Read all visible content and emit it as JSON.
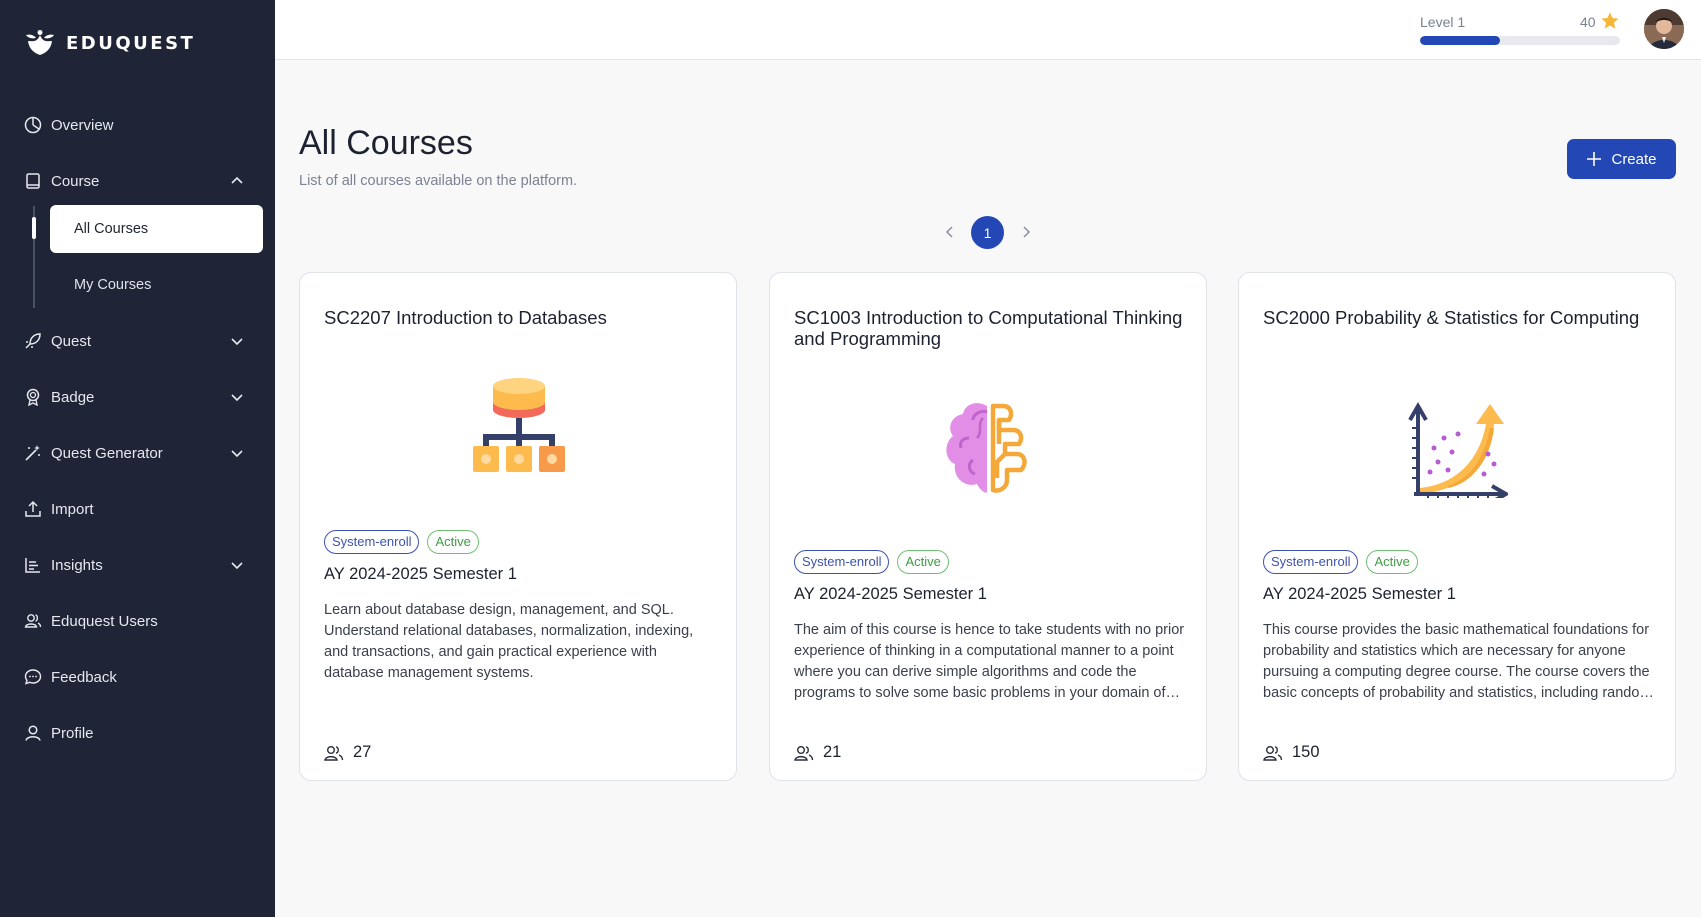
{
  "app": {
    "brand": "EDUQUEST"
  },
  "sidebar": {
    "items": [
      {
        "label": "Overview",
        "icon": "chart-pie-icon"
      },
      {
        "label": "Course",
        "icon": "book-icon",
        "expanded": true
      },
      {
        "label": "Quest",
        "icon": "rocket-icon"
      },
      {
        "label": "Badge",
        "icon": "badge-icon"
      },
      {
        "label": "Quest Generator",
        "icon": "magic-wand-icon"
      },
      {
        "label": "Import",
        "icon": "upload-icon"
      },
      {
        "label": "Insights",
        "icon": "insights-icon"
      },
      {
        "label": "Eduquest Users",
        "icon": "users-icon"
      },
      {
        "label": "Feedback",
        "icon": "chat-icon"
      },
      {
        "label": "Profile",
        "icon": "user-icon"
      }
    ],
    "course_sub": [
      {
        "label": "All Courses",
        "active": true
      },
      {
        "label": "My Courses",
        "active": false
      }
    ]
  },
  "topbar": {
    "level": "Level 1",
    "xp": "40",
    "progress_fraction": 0.4
  },
  "main": {
    "title": "All Courses",
    "subtitle": "List of all courses available on the platform.",
    "create_label": "Create",
    "pagination": {
      "current": "1"
    }
  },
  "courses": [
    {
      "title": "SC2207 Introduction to Databases",
      "image_icon": "database-hierarchy-icon",
      "tags": [
        "System-enroll",
        "Active"
      ],
      "term": "AY 2024-2025 Semester 1",
      "description": "Learn about database design, management, and SQL. Understand relational databases, normalization, indexing, and transactions, and gain practical experience with database management systems.",
      "users": "27"
    },
    {
      "title": "SC1003 Introduction to Computational Thinking and Programming",
      "image_icon": "brain-circuit-icon",
      "tags": [
        "System-enroll",
        "Active"
      ],
      "term": "AY 2024-2025 Semester 1",
      "description": "The aim of this course is hence to take students with no prior experience of thinking in a computational manner to a point where you can derive simple algorithms and code the programs to solve some basic problems in your domain of study.",
      "users": "21"
    },
    {
      "title": "SC2000 Probability & Statistics for Computing",
      "image_icon": "growth-chart-icon",
      "tags": [
        "System-enroll",
        "Active"
      ],
      "term": "AY 2024-2025 Semester 1",
      "description": "This course provides the basic mathematical foundations for probability and statistics which are necessary for anyone pursuing a computing degree course. The course covers the basic concepts of probability and statistics, including random variables and distributions.",
      "users": "150"
    }
  ],
  "colors": {
    "sidebar_bg": "#1f2536",
    "accent": "#2347b4",
    "tag_blue": "#3d52b0",
    "tag_green": "#3f9c46"
  }
}
